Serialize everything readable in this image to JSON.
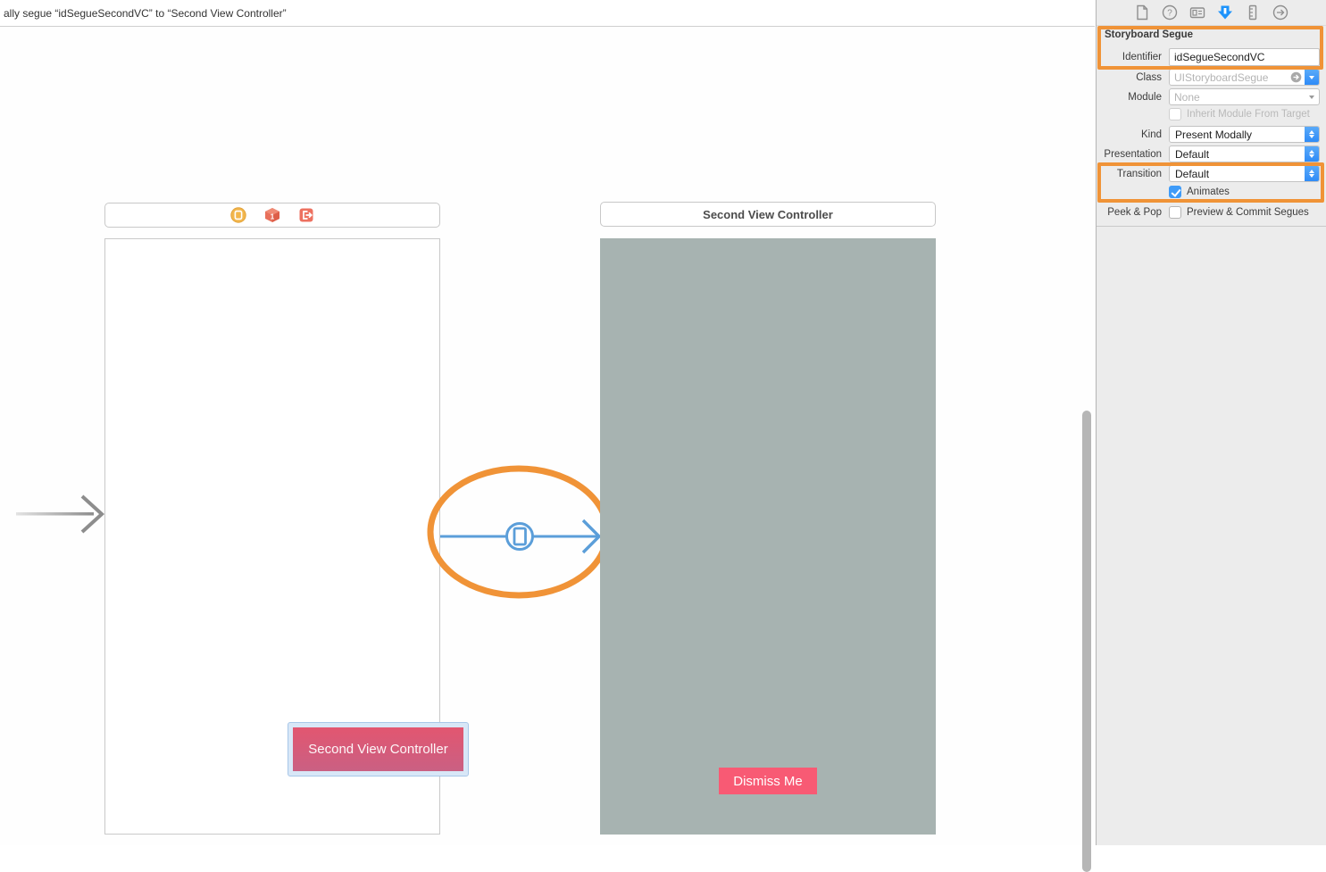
{
  "jump_bar": {
    "text": "ally segue “idSegueSecondVC” to “Second View Controller”"
  },
  "inspector": {
    "toolbar_icons": [
      "file-inspector",
      "quick-help-inspector",
      "identity-inspector",
      "attributes-inspector-selected",
      "size-inspector",
      "connections-inspector"
    ],
    "section_title": "Storyboard Segue",
    "fields": {
      "identifier_label": "Identifier",
      "identifier_value": "idSegueSecondVC",
      "class_label": "Class",
      "class_placeholder": "UIStoryboardSegue",
      "module_label": "Module",
      "module_placeholder": "None",
      "inherit_label": "Inherit Module From Target",
      "inherit_checked": false,
      "kind_label": "Kind",
      "kind_value": "Present Modally",
      "presentation_label": "Presentation",
      "presentation_value": "Default",
      "transition_label": "Transition",
      "transition_value": "Default",
      "animates_label": "Animates",
      "animates_checked": true,
      "peek_pop_label": "Peek & Pop",
      "peek_pop_option": "Preview & Commit Segues",
      "peek_pop_checked": false
    }
  },
  "canvas": {
    "first_vc": {
      "header_icons": [
        "view-controller-icon",
        "first-responder-icon",
        "exit-icon"
      ],
      "button_label": "Second View Controller"
    },
    "segue": {
      "type": "present-modally",
      "annotated": true
    },
    "second_vc": {
      "title": "Second View Controller",
      "dismiss_button_label": "Dismiss Me"
    }
  },
  "colors": {
    "annotation_orange": "#f09337",
    "segue_blue": "#5b9ed9",
    "accent_blue": "#3e9bf8",
    "second_vc_background": "#a7b3b1",
    "dismiss_pink": "#f85a74",
    "button_gradient_top": "#e25670",
    "button_gradient_bottom": "#ca6083",
    "vc_icon_yellow": "#f2b64c",
    "vc_icon_salmon": "#e8705b"
  }
}
